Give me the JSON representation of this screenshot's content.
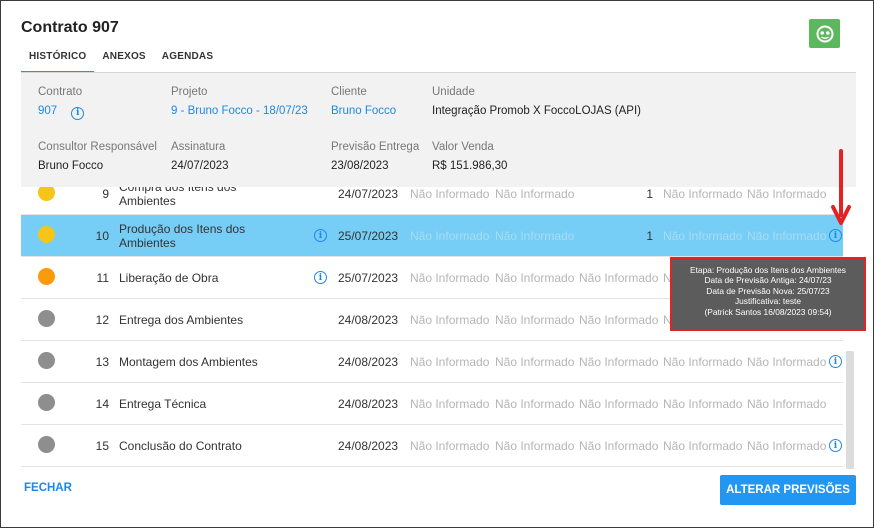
{
  "title": "Contrato 907",
  "tabs": [
    "HISTÓRICO",
    "ANEXOS",
    "AGENDAS"
  ],
  "active_tab": "HISTÓRICO",
  "info": {
    "contrato_label": "Contrato",
    "contrato_value": "907",
    "projeto_label": "Projeto",
    "projeto_value": "9 - Bruno Focco - 18/07/23",
    "cliente_label": "Cliente",
    "cliente_value": "Bruno Focco",
    "unidade_label": "Unidade",
    "unidade_value": "Integração Promob X FoccoLOJAS (API)",
    "consultor_label": "Consultor Responsável",
    "consultor_value": "Bruno Focco",
    "assinatura_label": "Assinatura",
    "assinatura_value": "24/07/2023",
    "previsao_label": "Previsão Entrega",
    "previsao_value": "23/08/2023",
    "valor_label": "Valor Venda",
    "valor_value": "R$ 151.986,30"
  },
  "rows": [
    {
      "num": "9",
      "name": "Compra dos Itens dos Ambientes",
      "date": "24/07/2023",
      "c1": "Não Informado",
      "c2": "Não Informado",
      "c3": "",
      "qty": "1",
      "c4": "Não Informado",
      "c5": "Não Informado",
      "status_color": "#f5c518",
      "name_info": false,
      "end_info": false
    },
    {
      "num": "10",
      "name": "Produção dos Itens dos Ambientes",
      "date": "25/07/2023",
      "c1": "Não Informado",
      "c2": "Não Informado",
      "c3": "",
      "qty": "1",
      "c4": "Não Informado",
      "c5": "Não Informado",
      "status_color": "#f5c518",
      "name_info": true,
      "end_info": true
    },
    {
      "num": "11",
      "name": "Liberação de Obra",
      "date": "25/07/2023",
      "c1": "Não Informado",
      "c2": "Não Informado",
      "c3": "Não Informado",
      "qty": "",
      "c4": "Não Informado",
      "c5": "",
      "status_color": "#fb9a0b",
      "name_info": true,
      "end_info": false
    },
    {
      "num": "12",
      "name": "Entrega dos Ambientes",
      "date": "24/08/2023",
      "c1": "Não Informado",
      "c2": "Não Informado",
      "c3": "Não Informado",
      "qty": "",
      "c4": "Não Informado",
      "c5": "",
      "status_color": "#8e8e8e",
      "name_info": false,
      "end_info": false
    },
    {
      "num": "13",
      "name": "Montagem dos Ambientes",
      "date": "24/08/2023",
      "c1": "Não Informado",
      "c2": "Não Informado",
      "c3": "Não Informado",
      "qty": "",
      "c4": "Não Informado",
      "c5": "Não Informado",
      "status_color": "#8e8e8e",
      "name_info": false,
      "end_info": true
    },
    {
      "num": "14",
      "name": "Entrega Técnica",
      "date": "24/08/2023",
      "c1": "Não Informado",
      "c2": "Não Informado",
      "c3": "Não Informado",
      "qty": "",
      "c4": "Não Informado",
      "c5": "Não Informado",
      "status_color": "#8e8e8e",
      "name_info": false,
      "end_info": false
    },
    {
      "num": "15",
      "name": "Conclusão do Contrato",
      "date": "24/08/2023",
      "c1": "Não Informado",
      "c2": "Não Informado",
      "c3": "Não Informado",
      "qty": "",
      "c4": "Não Informado",
      "c5": "Não Informado",
      "status_color": "#8e8e8e",
      "name_info": false,
      "end_info": true
    }
  ],
  "tooltip": {
    "line1": "Etapa: Produção dos Itens dos Ambientes",
    "line2": "Data de Previsão Antiga: 24/07/23",
    "line3": "Data de Previsão Nova: 25/07/23",
    "line4": "Justificativa: teste",
    "line5": "(Patrick Santos 16/08/2023 09:54)"
  },
  "footer": {
    "fechar": "FECHAR",
    "alterar": "ALTERAR PREVISÕES"
  },
  "colors": {
    "accent": "#2196f3",
    "selected_row": "#76cdf5",
    "logo": "#5cb85c",
    "annotation": "#e52222"
  }
}
